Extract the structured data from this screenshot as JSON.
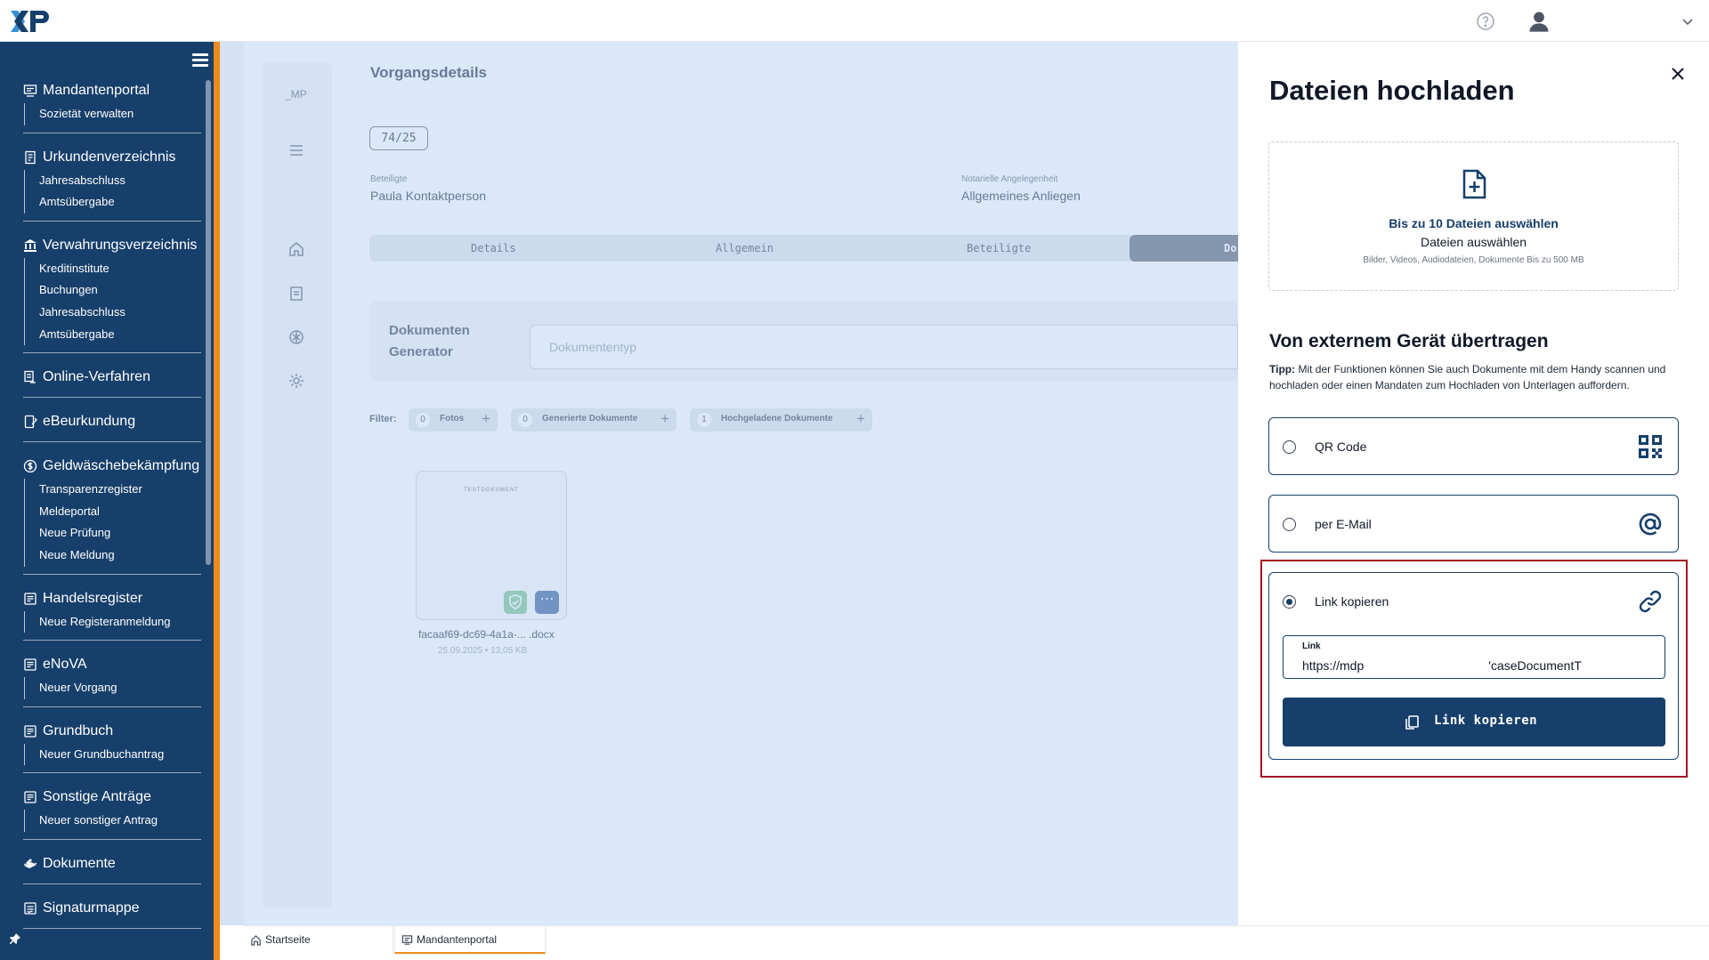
{
  "app": {
    "logo_text": "XP"
  },
  "sidebar": {
    "sections": [
      {
        "label": "Mandantenportal",
        "icon": "portal-icon",
        "items": [
          "Sozietät verwalten"
        ]
      },
      {
        "label": "Urkundenverzeichnis",
        "icon": "document-index-icon",
        "items": [
          "Jahresabschluss",
          "Amtsübergabe"
        ]
      },
      {
        "label": "Verwahrungsverzeichnis",
        "icon": "bank-icon",
        "items": [
          "Kreditinstitute",
          "Buchungen",
          "Jahresabschluss",
          "Amtsübergabe"
        ]
      },
      {
        "label": "Online-Verfahren",
        "icon": "online-procedure-icon",
        "items": []
      },
      {
        "label": "eBeurkundung",
        "icon": "tablet-icon",
        "items": []
      },
      {
        "label": "Geldwäschebekämpfung",
        "icon": "money-icon",
        "items": [
          "Transparenzregister",
          "Meldeportal",
          "Neue Prüfung",
          "Neue Meldung"
        ]
      },
      {
        "label": "Handelsregister",
        "icon": "register-icon",
        "items": [
          "Neue Registeranmeldung"
        ]
      },
      {
        "label": "eNoVA",
        "icon": "register-icon",
        "items": [
          "Neuer Vorgang"
        ]
      },
      {
        "label": "Grundbuch",
        "icon": "register-icon",
        "items": [
          "Neuer Grundbuchantrag"
        ]
      },
      {
        "label": "Sonstige Anträge",
        "icon": "register-icon",
        "items": [
          "Neuer sonstiger Antrag"
        ]
      },
      {
        "label": "Dokumente",
        "icon": "documents-icon",
        "items": []
      },
      {
        "label": "Signaturmappe",
        "icon": "signature-icon",
        "items": []
      }
    ]
  },
  "main": {
    "rail_label": "_MP",
    "title": "Vorgangsdetails",
    "case_number": "74/25",
    "beteiligte_label": "Beteiligte",
    "beteiligte_value": "Paula Kontaktperson",
    "angelegenheit_label": "Notarielle Angelegenheit",
    "angelegenheit_value": "Allgemeines Anliegen",
    "tabs": [
      "Details",
      "Allgemein",
      "Beteiligte",
      "Do"
    ],
    "generator_label": "Dokumenten Generator",
    "generator_placeholder": "Dokumententyp",
    "filter_label": "Filter:",
    "filters": [
      {
        "count": "0",
        "label": "Fotos"
      },
      {
        "count": "0",
        "label": "Generierte Dokumente"
      },
      {
        "count": "1",
        "label": "Hochgeladene Dokumente"
      }
    ],
    "document": {
      "preview_title": "TESTDOKUMENT",
      "name": "facaaf69-dc69-4a1a-... .docx",
      "meta": "25.09.2025  •  13,05 KB"
    }
  },
  "bottom_tabs": [
    "Startseite",
    "Mandantenportal"
  ],
  "panel": {
    "title": "Dateien hochladen",
    "dropzone_title": "Bis zu 10 Dateien auswählen",
    "dropzone_sub": "Dateien auswählen",
    "dropzone_hint": "Bilder, Videos, Audiodateien, Dokumente Bis zu 500 MB",
    "section_title": "Von externem Gerät übertragen",
    "tip_label": "Tipp:",
    "tip_text": " Mit der Funktionen können Sie auch Dokumente mit dem Handy scannen und hochladen oder einen Mandaten zum Hochladen von Unterlagen auffordern.",
    "options": [
      {
        "label": "QR Code",
        "icon": "qr-code-icon",
        "selected": false
      },
      {
        "label": "per E-Mail",
        "icon": "at-sign-icon",
        "selected": false
      },
      {
        "label": "Link kopieren",
        "icon": "link-icon",
        "selected": true
      }
    ],
    "link_field_label": "Link",
    "link_field_value": "https://mdp                                    'caseDocumentT",
    "copy_button_label": "Link kopieren"
  },
  "colors": {
    "brand": "#173f6b",
    "accent": "#f08a1b",
    "highlight": "#a31522"
  }
}
